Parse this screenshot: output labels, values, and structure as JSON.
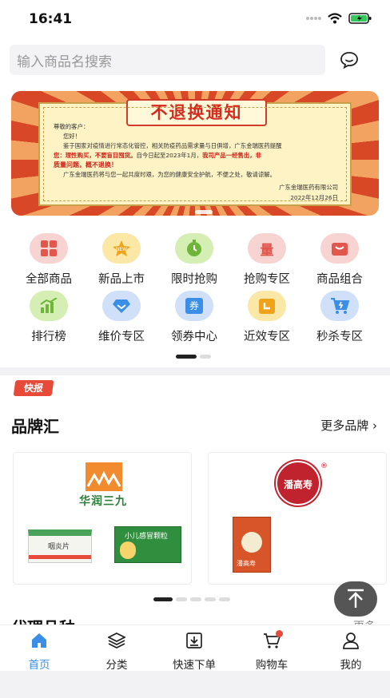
{
  "status": {
    "time": "16:41"
  },
  "search": {
    "placeholder": "输入商品名搜索",
    "message_icon": "chat-bubble-icon"
  },
  "banner": {
    "title": "不退换通知",
    "greeting": "尊敬的客户：",
    "hello": "您好！",
    "line1": "鉴于国家对疫情进行常态化管控，相关防疫药品需求量与日俱增，广东金瑞医药提醒",
    "line2a": "您：理性购买，不要盲目囤货。",
    "line2b": "自今日起至2023年1月，",
    "line2c": "我司产品一经售出，非",
    "line3": "质量问题，概不退换！",
    "line4": "广东金瑞医药将与您一起共度时艰，为您的健康安全护航，不便之处，敬请谅解。",
    "company": "广东金瑞医药有限公司",
    "date": "2022年12月26日"
  },
  "categories": [
    {
      "label": "全部商品",
      "icon": "grid-icon",
      "color": "#f7d4d1",
      "fg": "#e2574c"
    },
    {
      "label": "新品上市",
      "icon": "new-badge-icon",
      "color": "#fbe7a6",
      "fg": "#f0a31a"
    },
    {
      "label": "限时抢购",
      "icon": "stopwatch-icon",
      "color": "#d5eeb3",
      "fg": "#6fb53a"
    },
    {
      "label": "抢购专区",
      "icon": "quantity-icon",
      "color": "#f7d4d1",
      "fg": "#e2574c"
    },
    {
      "label": "商品组合",
      "icon": "bag-icon",
      "color": "#f7d4d1",
      "fg": "#e2574c"
    },
    {
      "label": "排行榜",
      "icon": "bar-chart-icon",
      "color": "#d5eeb3",
      "fg": "#6fb53a"
    },
    {
      "label": "维价专区",
      "icon": "diamond-icon",
      "color": "#cfe0f8",
      "fg": "#3a8ee6"
    },
    {
      "label": "领券中心",
      "icon": "coupon-icon",
      "color": "#cfe0f8",
      "fg": "#3a8ee6"
    },
    {
      "label": "近效专区",
      "icon": "calendar-icon",
      "color": "#fbe7a6",
      "fg": "#f0a31a"
    },
    {
      "label": "秒杀专区",
      "icon": "cart-icon",
      "color": "#cfe0f8",
      "fg": "#3a8ee6"
    }
  ],
  "news": {
    "badge": "快报"
  },
  "brands": {
    "title": "品牌汇",
    "more": "更多品牌 ›",
    "cards": [
      {
        "brand": "华润三九",
        "product_a": "咽炎片",
        "product_b": "小儿感冒颗粒"
      },
      {
        "brand": "潘高寿",
        "product_a": "潘高寿"
      }
    ]
  },
  "next_section": {
    "title": "代理品种",
    "more": "更多"
  },
  "tabbar": [
    {
      "label": "首页",
      "icon": "home-icon",
      "active": true
    },
    {
      "label": "分类",
      "icon": "layers-icon",
      "active": false
    },
    {
      "label": "快速下单",
      "icon": "quick-order-icon",
      "active": false
    },
    {
      "label": "购物车",
      "icon": "shopping-cart-icon",
      "active": false
    },
    {
      "label": "我的",
      "icon": "user-icon",
      "active": false
    }
  ],
  "colors": {
    "accent": "#3a8ee6",
    "red": "#e84a3a"
  }
}
